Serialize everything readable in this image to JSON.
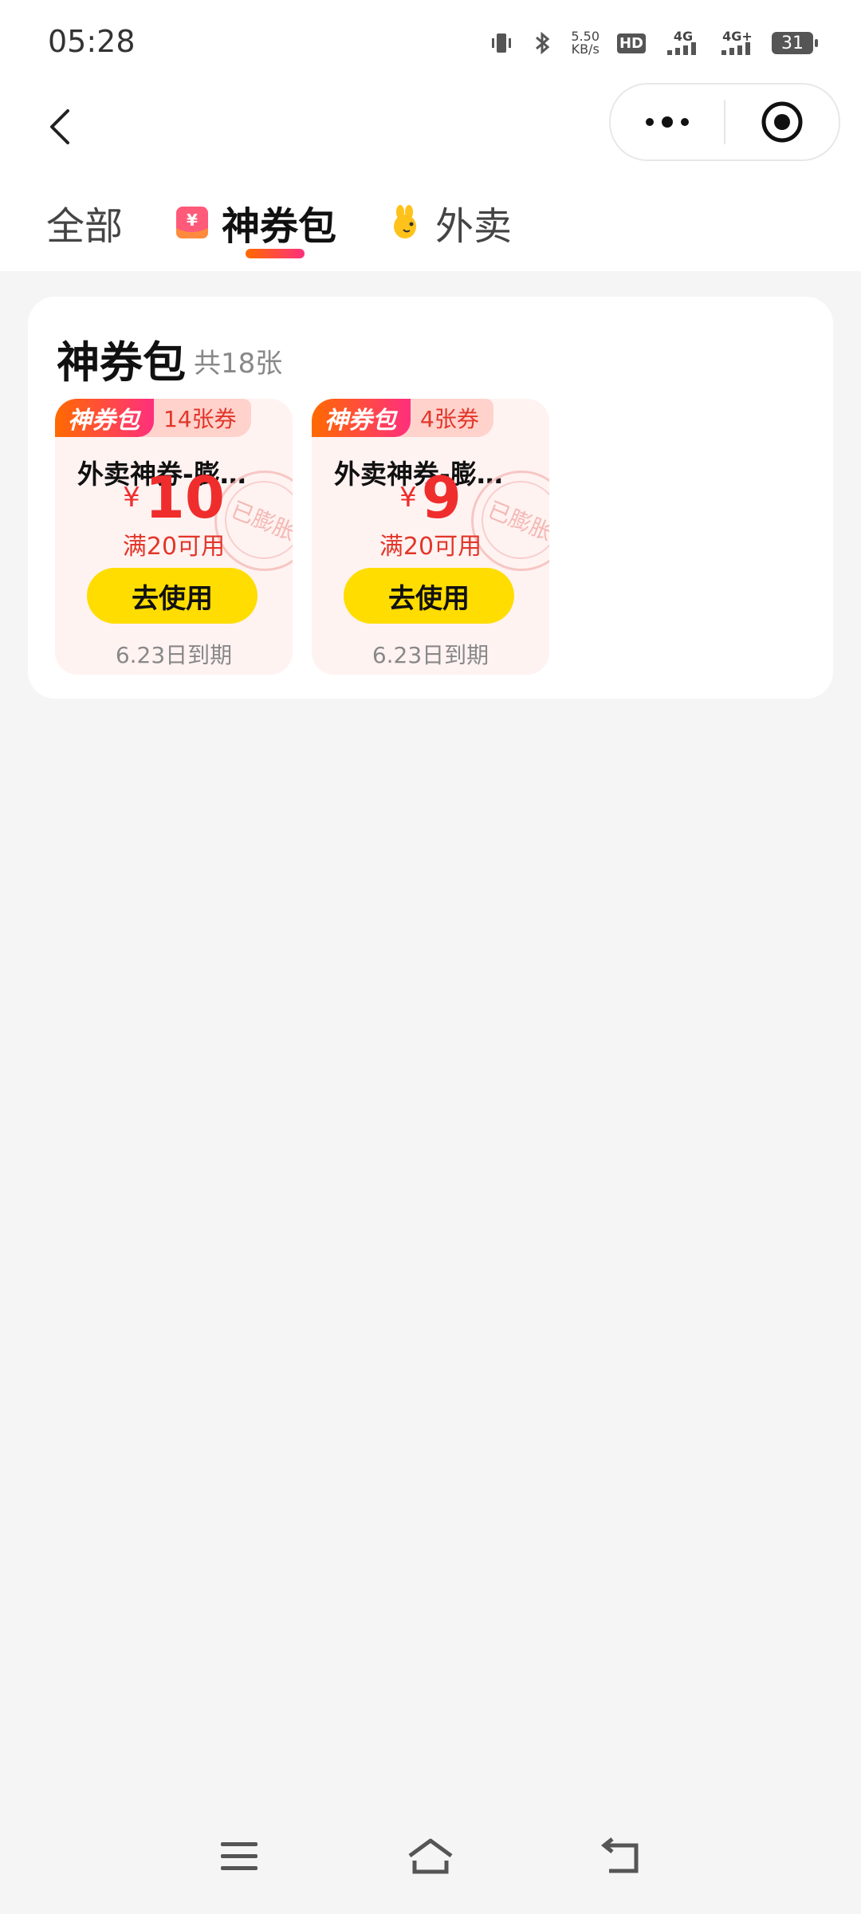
{
  "status_bar": {
    "time": "05:28",
    "net_speed_value": "5.50",
    "net_speed_unit": "KB/s",
    "hd_label": "HD",
    "network_1": "4G",
    "network_2": "4G+",
    "battery": "31"
  },
  "nav": {
    "back_icon": "chevron-left-icon",
    "more_icon": "more-dots-icon",
    "close_icon": "target-circle-icon"
  },
  "tabs": [
    {
      "label": "全部",
      "active": false
    },
    {
      "label": "神券包",
      "active": true,
      "icon": "coupon-bag-icon"
    },
    {
      "label": "外卖",
      "active": false,
      "icon": "kangaroo-icon"
    }
  ],
  "section": {
    "title": "神券包",
    "count": "共18张"
  },
  "coupons": [
    {
      "badge": "神券包",
      "badge_count": "14张券",
      "name": "外卖神券-膨…",
      "currency": "¥",
      "amount": "10",
      "condition": "满20可用",
      "button": "去使用",
      "expire": "6.23日到期",
      "stamp": "已膨胀"
    },
    {
      "badge": "神券包",
      "badge_count": "4张券",
      "name": "外卖神券-膨…",
      "currency": "¥",
      "amount": "9",
      "condition": "满20可用",
      "button": "去使用",
      "expire": "6.23日到期",
      "stamp": "已膨胀"
    }
  ],
  "colors": {
    "accent_gradient_start": "#ff6a00",
    "accent_gradient_end": "#ff2f7d",
    "price_red": "#f02d2d",
    "button_yellow": "#ffdd00",
    "coupon_bg": "#fff3f2"
  },
  "bottom_nav": {
    "menu_icon": "menu-icon",
    "home_icon": "home-icon",
    "back_icon": "back-icon"
  }
}
